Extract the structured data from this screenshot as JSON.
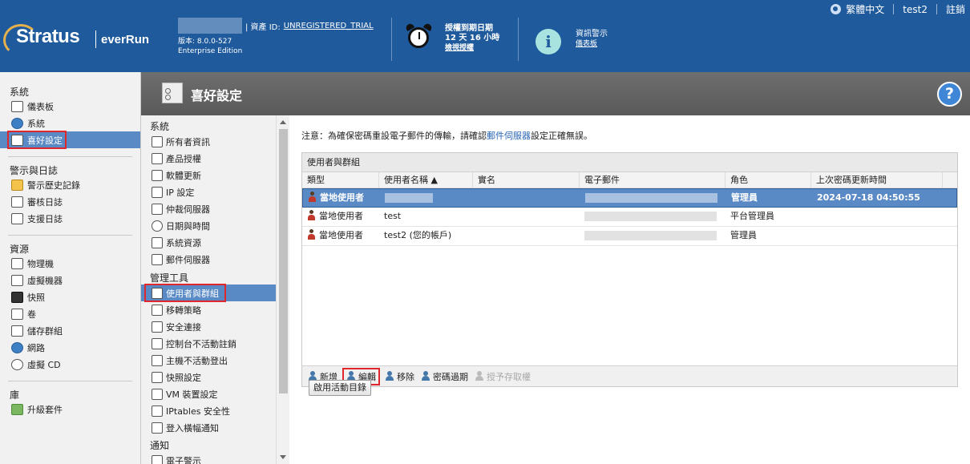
{
  "header": {
    "language": "繁體中文",
    "user": "test2",
    "logout": "註銷",
    "logo_main": "Stratus",
    "logo_sub": "everRun",
    "asset_label": "| 資產 ID:",
    "asset_value": "UNREGISTERED_TRIAL",
    "version": "版本: 8.0.0-527",
    "edition": "Enterprise Edition",
    "license_title": "授權到期日期",
    "license_days": "12 天 16 小時",
    "license_link": "檢視授權",
    "alert_title": "資訊警示",
    "alert_link": "儀表板"
  },
  "leftnav": {
    "sections": [
      {
        "title": "系統",
        "items": [
          {
            "label": "儀表板",
            "icon": "info-icon"
          },
          {
            "label": "系統",
            "icon": "globe-icon"
          },
          {
            "label": "喜好設定",
            "icon": "preferences-icon",
            "active": true
          }
        ]
      },
      {
        "title": "警示與日誌",
        "items": [
          {
            "label": "警示歷史記錄",
            "icon": "alert-bell-icon"
          },
          {
            "label": "審核日誌",
            "icon": "calendar-icon"
          },
          {
            "label": "支援日誌",
            "icon": "support-log-icon"
          }
        ]
      },
      {
        "title": "資源",
        "items": [
          {
            "label": "物理機",
            "icon": "server-icon"
          },
          {
            "label": "虛擬機器",
            "icon": "vm-icon"
          },
          {
            "label": "快照",
            "icon": "camera-icon"
          },
          {
            "label": "卷",
            "icon": "volume-icon"
          },
          {
            "label": "儲存群組",
            "icon": "storage-icon"
          },
          {
            "label": "網路",
            "icon": "network-icon"
          },
          {
            "label": "虛擬 CD",
            "icon": "cd-icon"
          }
        ]
      },
      {
        "title": "庫",
        "items": [
          {
            "label": "升級套件",
            "icon": "upgrade-icon"
          }
        ]
      }
    ]
  },
  "title": "喜好設定",
  "subnav": {
    "sections": [
      {
        "title": "系統",
        "items": [
          {
            "label": "所有者資訊",
            "icon": "owner-icon"
          },
          {
            "label": "產品授權",
            "icon": "lock-icon"
          },
          {
            "label": "軟體更新",
            "icon": "update-icon"
          },
          {
            "label": "IP 設定",
            "icon": "globe-icon"
          },
          {
            "label": "仲裁伺服器",
            "icon": "quorum-icon"
          },
          {
            "label": "日期與時間",
            "icon": "clock-icon"
          },
          {
            "label": "系統資源",
            "icon": "chip-icon"
          },
          {
            "label": "郵件伺服器",
            "icon": "mail-icon"
          }
        ]
      },
      {
        "title": "管理工具",
        "items": [
          {
            "label": "使用者與群組",
            "icon": "users-icon",
            "active": true
          },
          {
            "label": "移轉策略",
            "icon": "migrate-icon"
          },
          {
            "label": "安全連接",
            "icon": "lock-icon"
          },
          {
            "label": "控制台不活動註銷",
            "icon": "lock-icon"
          },
          {
            "label": "主機不活動登出",
            "icon": "lock-icon"
          },
          {
            "label": "快照設定",
            "icon": "camera-icon"
          },
          {
            "label": "VM 裝置設定",
            "icon": "vm-icon"
          },
          {
            "label": "IPtables 安全性",
            "icon": "shield-icon"
          },
          {
            "label": "登入橫幅通知",
            "icon": "info-icon"
          }
        ]
      },
      {
        "title": "通知",
        "items": [
          {
            "label": "電子警示",
            "icon": "mail-icon"
          }
        ]
      }
    ]
  },
  "main": {
    "notice_prefix": "注意：為確保密碼重設電子郵件的傳輸，請確認",
    "notice_link": "郵件伺服器",
    "notice_suffix": "設定正確無誤。",
    "panel_title": "使用者與群組",
    "columns": [
      "類型",
      "使用者名稱 ▲",
      "實名",
      "電子郵件",
      "角色",
      "上次密碼更新時間"
    ],
    "rows": [
      {
        "type": "當地使用者",
        "username": "",
        "realname": "",
        "email": "",
        "role": "管理員",
        "updated": "2024-07-18 04:50:55"
      },
      {
        "type": "當地使用者",
        "username": "test",
        "realname": "",
        "email": "",
        "role": "平台管理員",
        "updated": ""
      },
      {
        "type": "當地使用者",
        "username": "test2 (您的帳戶)",
        "realname": "",
        "email": "",
        "role": "管理員",
        "updated": ""
      }
    ],
    "toolbar": {
      "add": "新增",
      "edit": "編輯",
      "remove": "移除",
      "expire": "密碼過期",
      "grant": "授予存取權"
    },
    "ad_button": "啟用活動目錄"
  }
}
